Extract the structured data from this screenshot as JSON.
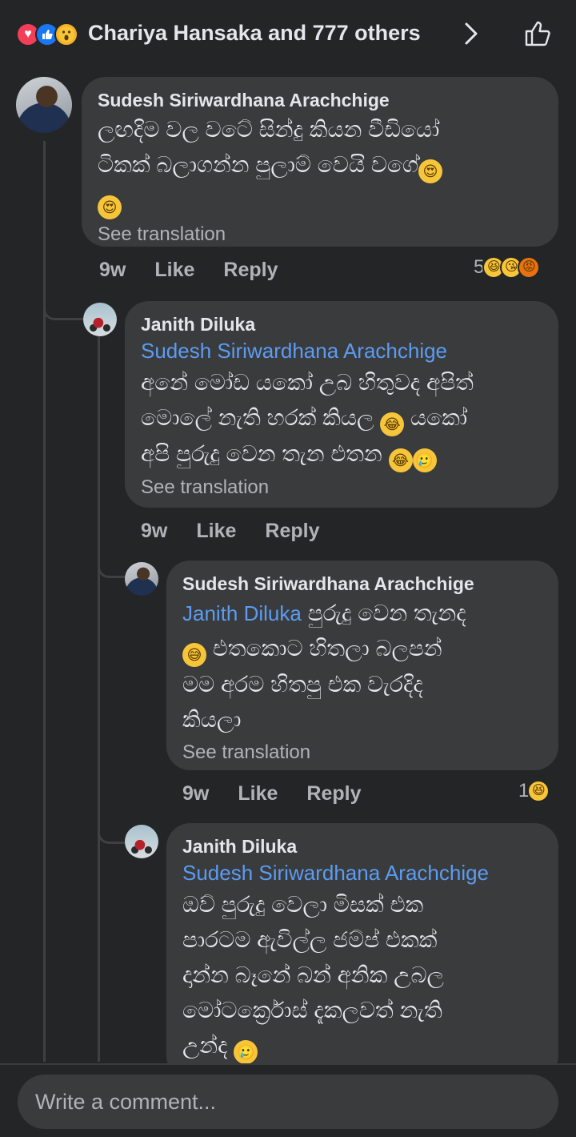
{
  "reactions_summary": {
    "text": "Chariya Hansaka and 777 others",
    "chevron": ">",
    "icons": [
      "love",
      "like",
      "wow"
    ]
  },
  "comments": [
    {
      "author": "Sudesh Siriwardhana Arachchige",
      "mention": "",
      "text_line1": "ලඟදිම වල වටේ සින්දු කියන වීඩියෝ",
      "text_line2": "ටිකක් බලාගන්න පුලාම් වෙයි වගේ",
      "text_line3": "",
      "text_line4": "",
      "translate": "See translation",
      "time": "9w",
      "like": "Like",
      "reply": "Reply",
      "reaction_count": "5"
    },
    {
      "author": "Janith Diluka",
      "mention": "Sudesh Siriwardhana Arachchige",
      "text_line1": "අනේ මෝඩ යකෝ උබ හිතුවද අපිත්",
      "text_line2": "මොලේ නැති හරක් කියල",
      "text_line2b": "යකෝ",
      "text_line3": "අපි පුරුදු වෙන තැන එතන",
      "translate": "See translation",
      "time": "9w",
      "like": "Like",
      "reply": "Reply",
      "reaction_count": ""
    },
    {
      "author": "Sudesh Siriwardhana Arachchige",
      "mention": "Janith Diluka",
      "mention_tail": "පුරුදු වෙන තැනද",
      "text_line1": "එතකොට හිතලා බලපන්",
      "text_line2": "මම අරම හිතපු එක වැරදිද",
      "text_line3": "කියලා",
      "translate": "See translation",
      "time": "9w",
      "like": "Like",
      "reply": "Reply",
      "reaction_count": "1"
    },
    {
      "author": "Janith Diluka",
      "mention": "Sudesh Siriwardhana Arachchige",
      "text_line1": "ඔව් පුරුදු වෙලා මිසක් එක",
      "text_line2": "පාරටම ඇවිල්ල ජම්ප් එකක්",
      "text_line3": "දාන්න බෑනේ බන් අනික උබල",
      "text_line4": "මෝටර්ක්‍රොස් දැකලවත් නැති",
      "text_line5": "උන්ද",
      "translate": "",
      "time": "",
      "like": "",
      "reply": "",
      "reaction_count": ""
    }
  ],
  "composer": {
    "placeholder": "Write a comment..."
  }
}
